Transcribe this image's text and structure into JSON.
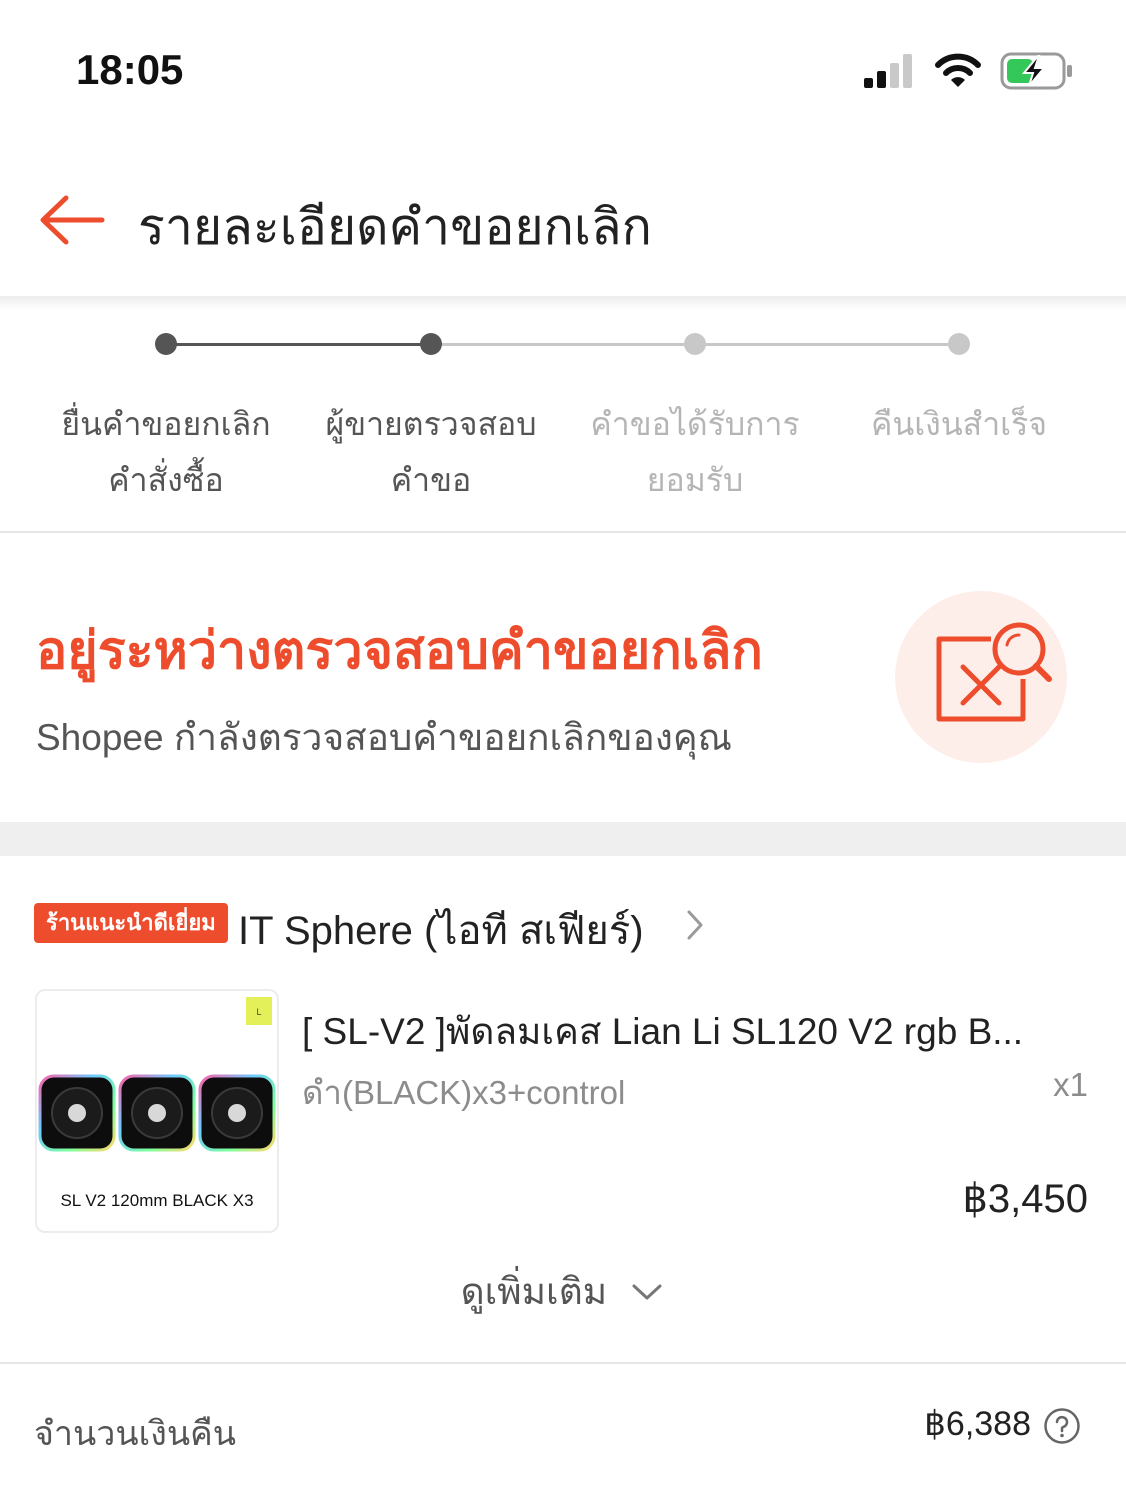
{
  "status_bar": {
    "time": "18:05",
    "icons": [
      "signal-icon",
      "wifi-icon",
      "battery-charging-icon"
    ]
  },
  "header": {
    "title": "รายละเอียดคำขอยกเลิก",
    "back_icon": "arrow-left-icon"
  },
  "stepper": {
    "steps": [
      {
        "line1": "ยื่นคำขอยกเลิก",
        "line2": "คำสั่งซื้อ",
        "state": "done"
      },
      {
        "line1": "ผู้ขายตรวจสอบ",
        "line2": "คำขอ",
        "state": "done"
      },
      {
        "line1": "คำขอได้รับการ",
        "line2": "ยอมรับ",
        "state": "pending"
      },
      {
        "line1": "คืนเงินสำเร็จ",
        "line2": "",
        "state": "pending"
      }
    ]
  },
  "status": {
    "title": "อยู่ระหว่างตรวจสอบคำขอยกเลิก",
    "description": "Shopee กำลังตรวจสอบคำขอยกเลิกของคุณ",
    "icon": "document-search-icon"
  },
  "shop": {
    "badge": "ร้านแนะนำดีเยี่ยม",
    "name": "IT Sphere (ไอที สเฟียร์)"
  },
  "product": {
    "name": "[ SL-V2 ]พัดลมเคส Lian Li SL120 V2 rgb B...",
    "variant": "ดำ(BLACK)x3+control",
    "quantity": "x1",
    "price": "฿3,450",
    "thumbnail_caption": "SL V2 120mm BLACK X3"
  },
  "see_more": "ดูเพิ่มเติม",
  "refund": {
    "label": "จำนวนเงินคืน",
    "amount": "฿6,388"
  },
  "colors": {
    "accent": "#ee4d2d",
    "step_done": "#555555",
    "step_pending": "#c8c8c8",
    "text_muted": "#8c8c8c"
  }
}
